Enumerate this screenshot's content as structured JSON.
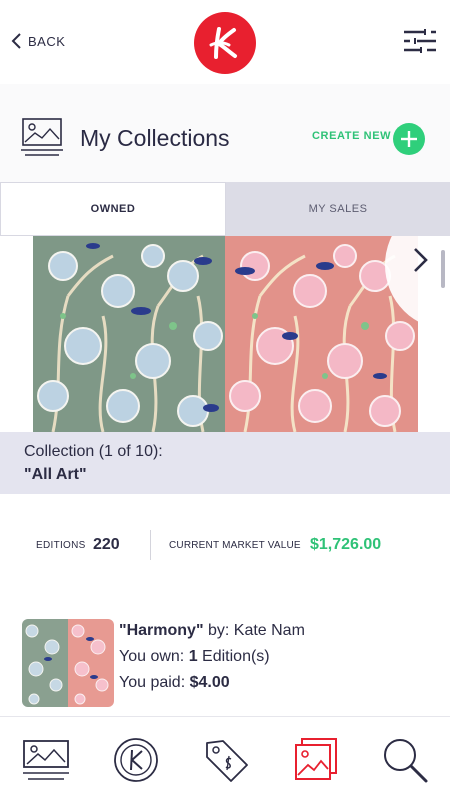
{
  "topbar": {
    "back_label": "BACK",
    "logo_icon": "k-logo-icon",
    "menu_icon": "filter-menu-icon",
    "brand_color": "#e8202f"
  },
  "header": {
    "title": "My Collections",
    "create_label": "CREATE NEW",
    "icon": "collection-gallery-icon",
    "accent_color": "#2fcf7b"
  },
  "tabs": [
    {
      "label": "OWNED",
      "active": true
    },
    {
      "label": "MY SALES",
      "active": false
    }
  ],
  "collection": {
    "label": "Collection (1 of 10):",
    "name": "\"All Art\""
  },
  "stats": {
    "editions_label": "EDITIONS",
    "editions_value": "220",
    "market_label": "CURRENT MARKET VALUE",
    "market_value": "$1,726.00"
  },
  "item": {
    "title": "\"Harmony\"",
    "by_label": " by: Kate Nam",
    "own_label": "You own: ",
    "own_value": "1",
    "own_suffix": " Edition(s)",
    "paid_label": "You paid: ",
    "paid_value": "$4.00"
  },
  "bottom_nav": [
    {
      "icon": "gallery-icon",
      "active": false
    },
    {
      "icon": "coin-k-icon",
      "active": false
    },
    {
      "icon": "price-tag-icon",
      "active": false
    },
    {
      "icon": "collection-icon",
      "active": true
    },
    {
      "icon": "search-icon",
      "active": false
    }
  ]
}
